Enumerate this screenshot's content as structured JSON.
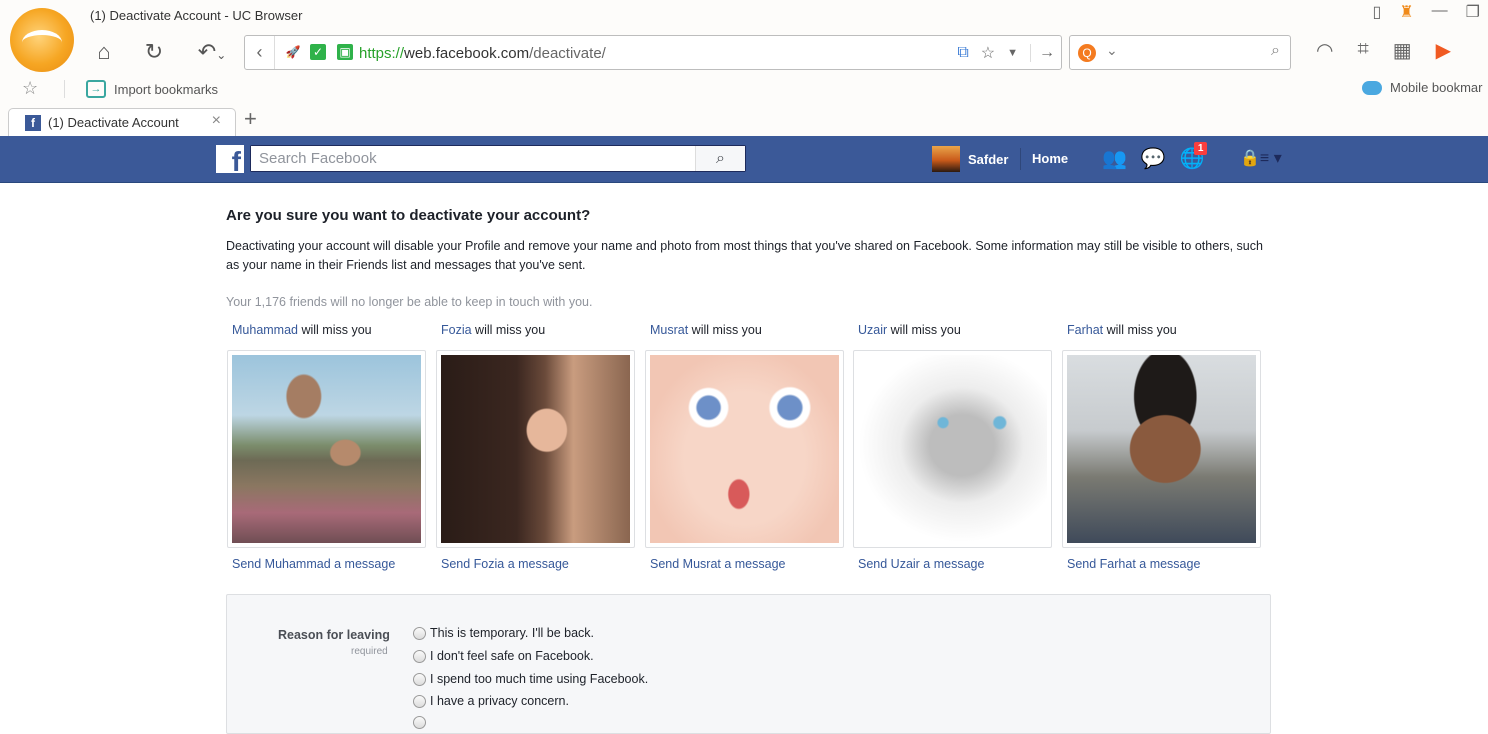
{
  "browser": {
    "window_title": "(1) Deactivate Account - UC Browser",
    "url_https": "https://",
    "url_domain": "web.facebook.com",
    "url_path": "/deactivate/",
    "bookmarks": {
      "import": "Import bookmarks",
      "mobile": "Mobile bookmar"
    },
    "tab_label": "(1) Deactivate Account"
  },
  "facebook": {
    "search_placeholder": "Search Facebook",
    "user_name": "Safder",
    "home": "Home",
    "notification_count": "1"
  },
  "page": {
    "heading": "Are you sure you want to deactivate your account?",
    "description": "Deactivating your account will disable your Profile and remove your name and photo from most things that you've shared on Facebook. Some information may still be visible to others, such as your name in their Friends list and messages that you've sent.",
    "friends_notice": "Your 1,176 friends will no longer be able to keep in touch with you.",
    "miss_suffix": " will miss you",
    "friends": [
      {
        "name": "Muhammad",
        "send": "Send Muhammad a message"
      },
      {
        "name": "Fozia",
        "send": "Send Fozia a message"
      },
      {
        "name": "Musrat",
        "send": "Send Musrat a message"
      },
      {
        "name": "Uzair",
        "send": "Send Uzair a message"
      },
      {
        "name": "Farhat",
        "send": "Send Farhat a message"
      }
    ],
    "reason": {
      "label": "Reason for leaving",
      "required": "required",
      "options": [
        "This is temporary. I'll be back.",
        "I don't feel safe on Facebook.",
        "I spend too much time using Facebook.",
        "I have a privacy concern."
      ]
    }
  }
}
